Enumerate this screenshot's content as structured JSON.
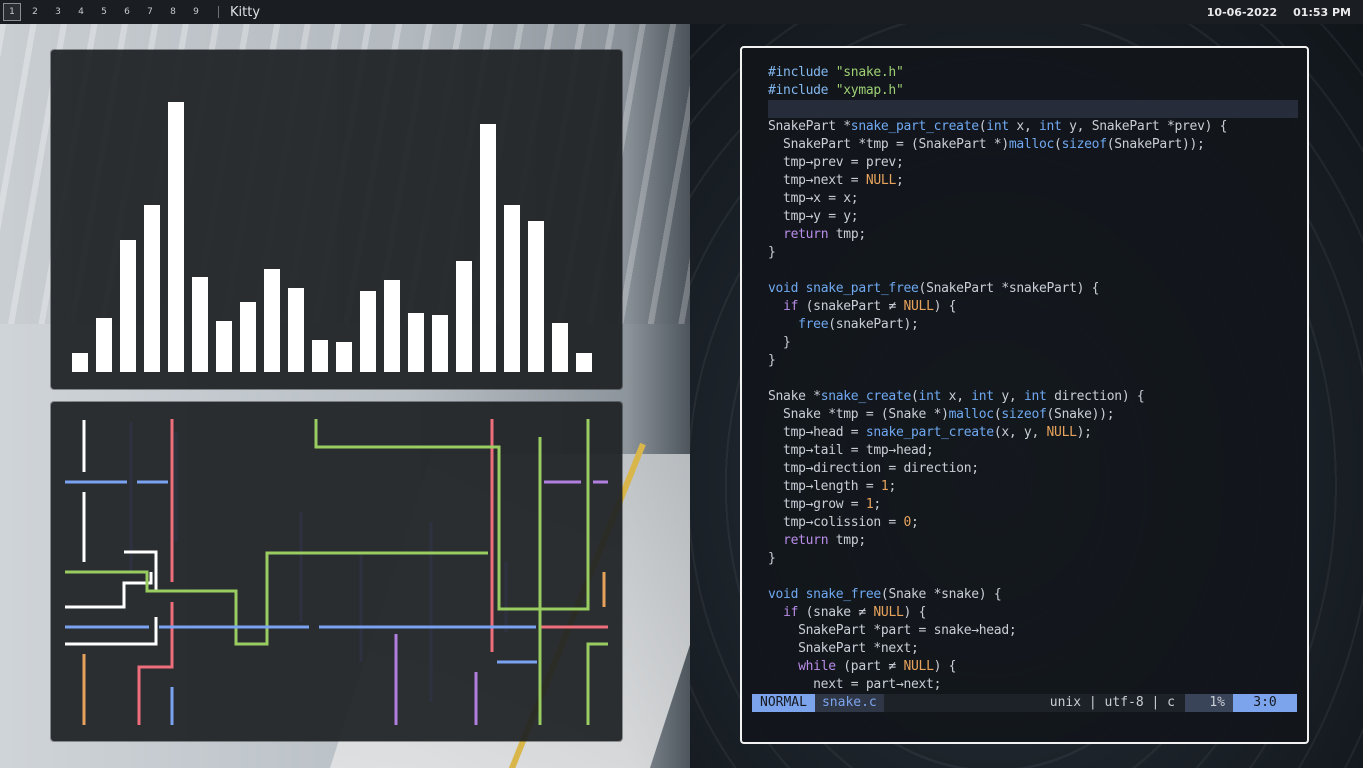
{
  "topbar": {
    "workspaces": [
      {
        "label": "1",
        "active": true
      },
      {
        "label": "2",
        "active": false
      },
      {
        "label": "3",
        "active": false
      },
      {
        "label": "4",
        "active": false
      },
      {
        "label": "5",
        "active": false
      },
      {
        "label": "6",
        "active": false
      },
      {
        "label": "7",
        "active": false
      },
      {
        "label": "8",
        "active": false
      },
      {
        "label": "9",
        "active": false
      }
    ],
    "window_title": "Kitty",
    "date": "10-06-2022",
    "time": "01:53 PM"
  },
  "visualizer": {
    "bar_color": "#ffffff",
    "levels": [
      0.07,
      0.2,
      0.49,
      0.62,
      1.0,
      0.35,
      0.19,
      0.26,
      0.38,
      0.31,
      0.12,
      0.11,
      0.3,
      0.34,
      0.22,
      0.21,
      0.41,
      0.92,
      0.62,
      0.56,
      0.18,
      0.07
    ]
  },
  "pipes": {
    "colors": {
      "white": "#ffffff",
      "red": "#ee6f7b",
      "green": "#9acd61",
      "blue": "#7aa2f0",
      "purple": "#b07fe0",
      "orange": "#e6a25a",
      "dark": "#2d3140"
    }
  },
  "terminal": {
    "code_lines": [
      [
        {
          "t": "#include ",
          "c": "pp"
        },
        {
          "t": "\"snake.h\"",
          "c": "str"
        }
      ],
      [
        {
          "t": "#include ",
          "c": "pp"
        },
        {
          "t": "\"xymap.h\"",
          "c": "str"
        }
      ],
      [],
      [
        {
          "t": "SnakePart *",
          "c": "plain"
        },
        {
          "t": "snake_part_create",
          "c": "fn"
        },
        {
          "t": "(",
          "c": "plain"
        },
        {
          "t": "int",
          "c": "kw"
        },
        {
          "t": " x, ",
          "c": "plain"
        },
        {
          "t": "int",
          "c": "kw"
        },
        {
          "t": " y, SnakePart *prev) {",
          "c": "plain"
        }
      ],
      [
        {
          "t": "  SnakePart *tmp = (SnakePart *)",
          "c": "plain"
        },
        {
          "t": "malloc",
          "c": "fn"
        },
        {
          "t": "(",
          "c": "plain"
        },
        {
          "t": "sizeof",
          "c": "kw"
        },
        {
          "t": "(SnakePart));",
          "c": "plain"
        }
      ],
      [
        {
          "t": "  tmp→prev = prev;",
          "c": "plain"
        }
      ],
      [
        {
          "t": "  tmp→next = ",
          "c": "plain"
        },
        {
          "t": "NULL",
          "c": "num"
        },
        {
          "t": ";",
          "c": "plain"
        }
      ],
      [
        {
          "t": "  tmp→x = x;",
          "c": "plain"
        }
      ],
      [
        {
          "t": "  tmp→y = y;",
          "c": "plain"
        }
      ],
      [
        {
          "t": "  ",
          "c": "plain"
        },
        {
          "t": "return",
          "c": "ctl"
        },
        {
          "t": " tmp;",
          "c": "plain"
        }
      ],
      [
        {
          "t": "}",
          "c": "plain"
        }
      ],
      [],
      [
        {
          "t": "void",
          "c": "kw"
        },
        {
          "t": " ",
          "c": "plain"
        },
        {
          "t": "snake_part_free",
          "c": "fn"
        },
        {
          "t": "(SnakePart *snakePart) {",
          "c": "plain"
        }
      ],
      [
        {
          "t": "  ",
          "c": "plain"
        },
        {
          "t": "if",
          "c": "ctl"
        },
        {
          "t": " (snakePart ≠ ",
          "c": "plain"
        },
        {
          "t": "NULL",
          "c": "num"
        },
        {
          "t": ") {",
          "c": "plain"
        }
      ],
      [
        {
          "t": "    ",
          "c": "plain"
        },
        {
          "t": "free",
          "c": "fn"
        },
        {
          "t": "(snakePart);",
          "c": "plain"
        }
      ],
      [
        {
          "t": "  }",
          "c": "plain"
        }
      ],
      [
        {
          "t": "}",
          "c": "plain"
        }
      ],
      [],
      [
        {
          "t": "Snake *",
          "c": "plain"
        },
        {
          "t": "snake_create",
          "c": "fn"
        },
        {
          "t": "(",
          "c": "plain"
        },
        {
          "t": "int",
          "c": "kw"
        },
        {
          "t": " x, ",
          "c": "plain"
        },
        {
          "t": "int",
          "c": "kw"
        },
        {
          "t": " y, ",
          "c": "plain"
        },
        {
          "t": "int",
          "c": "kw"
        },
        {
          "t": " direction) {",
          "c": "plain"
        }
      ],
      [
        {
          "t": "  Snake *tmp = (Snake *)",
          "c": "plain"
        },
        {
          "t": "malloc",
          "c": "fn"
        },
        {
          "t": "(",
          "c": "plain"
        },
        {
          "t": "sizeof",
          "c": "kw"
        },
        {
          "t": "(Snake));",
          "c": "plain"
        }
      ],
      [
        {
          "t": "  tmp→head = ",
          "c": "plain"
        },
        {
          "t": "snake_part_create",
          "c": "fn"
        },
        {
          "t": "(x, y, ",
          "c": "plain"
        },
        {
          "t": "NULL",
          "c": "num"
        },
        {
          "t": ");",
          "c": "plain"
        }
      ],
      [
        {
          "t": "  tmp→tail = tmp→head;",
          "c": "plain"
        }
      ],
      [
        {
          "t": "  tmp→direction = direction;",
          "c": "plain"
        }
      ],
      [
        {
          "t": "  tmp→length = ",
          "c": "plain"
        },
        {
          "t": "1",
          "c": "num"
        },
        {
          "t": ";",
          "c": "plain"
        }
      ],
      [
        {
          "t": "  tmp→grow = ",
          "c": "plain"
        },
        {
          "t": "1",
          "c": "num"
        },
        {
          "t": ";",
          "c": "plain"
        }
      ],
      [
        {
          "t": "  tmp→colission = ",
          "c": "plain"
        },
        {
          "t": "0",
          "c": "num"
        },
        {
          "t": ";",
          "c": "plain"
        }
      ],
      [
        {
          "t": "  ",
          "c": "plain"
        },
        {
          "t": "return",
          "c": "ctl"
        },
        {
          "t": " tmp;",
          "c": "plain"
        }
      ],
      [
        {
          "t": "}",
          "c": "plain"
        }
      ],
      [],
      [
        {
          "t": "void",
          "c": "kw"
        },
        {
          "t": " ",
          "c": "plain"
        },
        {
          "t": "snake_free",
          "c": "fn"
        },
        {
          "t": "(Snake *snake) {",
          "c": "plain"
        }
      ],
      [
        {
          "t": "  ",
          "c": "plain"
        },
        {
          "t": "if",
          "c": "ctl"
        },
        {
          "t": " (snake ≠ ",
          "c": "plain"
        },
        {
          "t": "NULL",
          "c": "num"
        },
        {
          "t": ") {",
          "c": "plain"
        }
      ],
      [
        {
          "t": "    SnakePart *part = snake→head;",
          "c": "plain"
        }
      ],
      [
        {
          "t": "    SnakePart *next;",
          "c": "plain"
        }
      ],
      [
        {
          "t": "    ",
          "c": "plain"
        },
        {
          "t": "while",
          "c": "ctl"
        },
        {
          "t": " (part ≠ ",
          "c": "plain"
        },
        {
          "t": "NULL",
          "c": "num"
        },
        {
          "t": ") {",
          "c": "plain"
        }
      ],
      [
        {
          "t": "      next = part→next;",
          "c": "plain"
        }
      ]
    ],
    "cursor_line": 3,
    "status": {
      "mode": "NORMAL",
      "file": "snake.c",
      "info": "unix | utf-8 | c",
      "percent": "1%",
      "position": "3:0"
    }
  }
}
